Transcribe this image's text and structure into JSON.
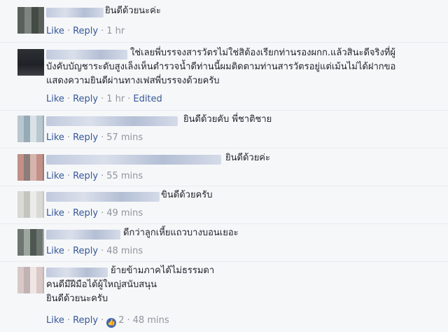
{
  "actions": {
    "like": "Like",
    "reply": "Reply",
    "edited": "Edited"
  },
  "comments": [
    {
      "lines": [
        "ยินดีด้วยนะค่ะ"
      ],
      "time": "1 hr"
    },
    {
      "lines": [
        "ใช่เลยพี่บรรจงสารวัตรไม่ใช่สิต้องเรียกท่านรองผกก.แล้วสินะดีจริงที่ผู้",
        "บังคับบัญชาระดับสูงเล็งเห็นตำรวจน้ำดีท่านนี้ผมติดตามท่านสารวัตรอยู่แต่เม้นไม่ได้ฝากขอ",
        "แสดงความยินดีผ่านทางเฟสพี่บรรจงด้วยครับ"
      ],
      "time": "1 hr"
    },
    {
      "lines": [
        "ยินดีด้วยคับ  พี่ชาติชาย"
      ],
      "time": "57 mins"
    },
    {
      "lines": [
        "ยินดีด้วยค่ะ"
      ],
      "time": "55 mins"
    },
    {
      "lines": [
        "ขินดีด้วยครับ"
      ],
      "time": "49 mins"
    },
    {
      "lines": [
        "ดีกว่าลูกเหี้ยแถวบางบอนเยอะ"
      ],
      "time": "48 mins"
    },
    {
      "lines": [
        "ย้ายข้ามภาคได้ไม่ธรรมดา",
        "คนดีมีฝีมือได้ผู้ใหญ่สนับสนุน",
        "ยินดีด้วยนะครับ"
      ],
      "time": "48 mins",
      "likes": "2"
    }
  ]
}
